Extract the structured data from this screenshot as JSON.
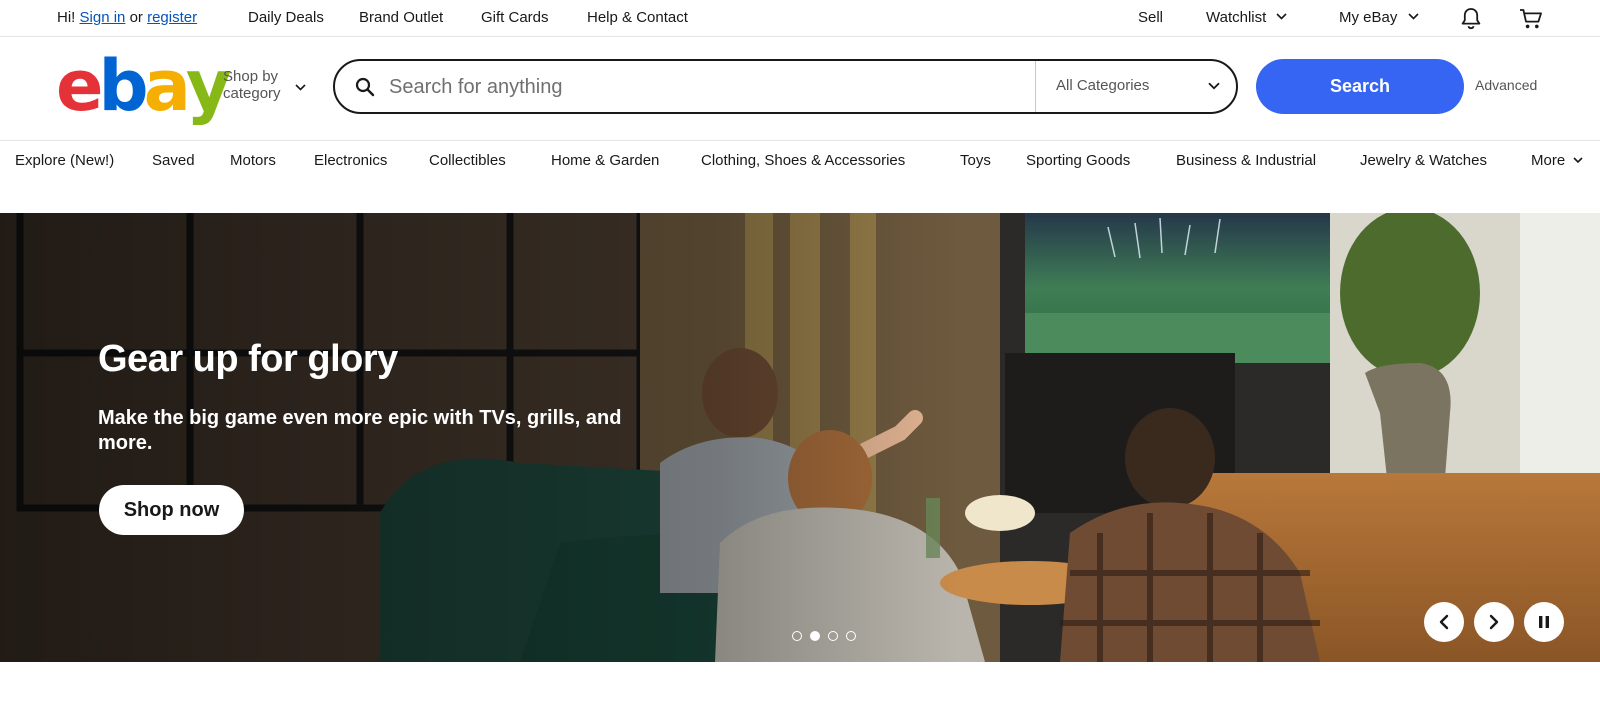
{
  "topbar": {
    "greeting_prefix": "Hi!",
    "sign_in": "Sign in",
    "or": "or",
    "register": "register",
    "links": [
      "Daily Deals",
      "Brand Outlet",
      "Gift Cards",
      "Help & Contact"
    ],
    "sell": "Sell",
    "watchlist": "Watchlist",
    "my_ebay": "My eBay"
  },
  "header": {
    "logo": {
      "e": "e",
      "b": "b",
      "a": "a",
      "y": "y"
    },
    "shop_by_line1": "Shop by",
    "shop_by_line2": "category",
    "search_placeholder": "Search for anything",
    "search_value": "",
    "category_selected": "All Categories",
    "search_button": "Search",
    "advanced": "Advanced"
  },
  "nav": {
    "items": [
      "Explore (New!)",
      "Saved",
      "Motors",
      "Electronics",
      "Collectibles",
      "Home & Garden",
      "Clothing, Shoes & Accessories",
      "Toys",
      "Sporting Goods",
      "Business & Industrial",
      "Jewelry & Watches",
      "More"
    ]
  },
  "hero": {
    "title": "Gear up for glory",
    "subtitle": "Make the big game even more epic with TVs, grills, and more.",
    "cta": "Shop now",
    "slide_count": 4,
    "active_slide": 2
  },
  "colors": {
    "brand_blue": "#3665f3",
    "link_blue": "#0654ba",
    "logo_red": "#e53238",
    "logo_blue": "#0064d2",
    "logo_yellow": "#f5af02",
    "logo_green": "#86b817"
  },
  "icons": [
    "chevron-down-icon",
    "bell-icon",
    "cart-icon",
    "search-icon",
    "chevron-left-icon",
    "chevron-right-icon",
    "pause-icon"
  ]
}
